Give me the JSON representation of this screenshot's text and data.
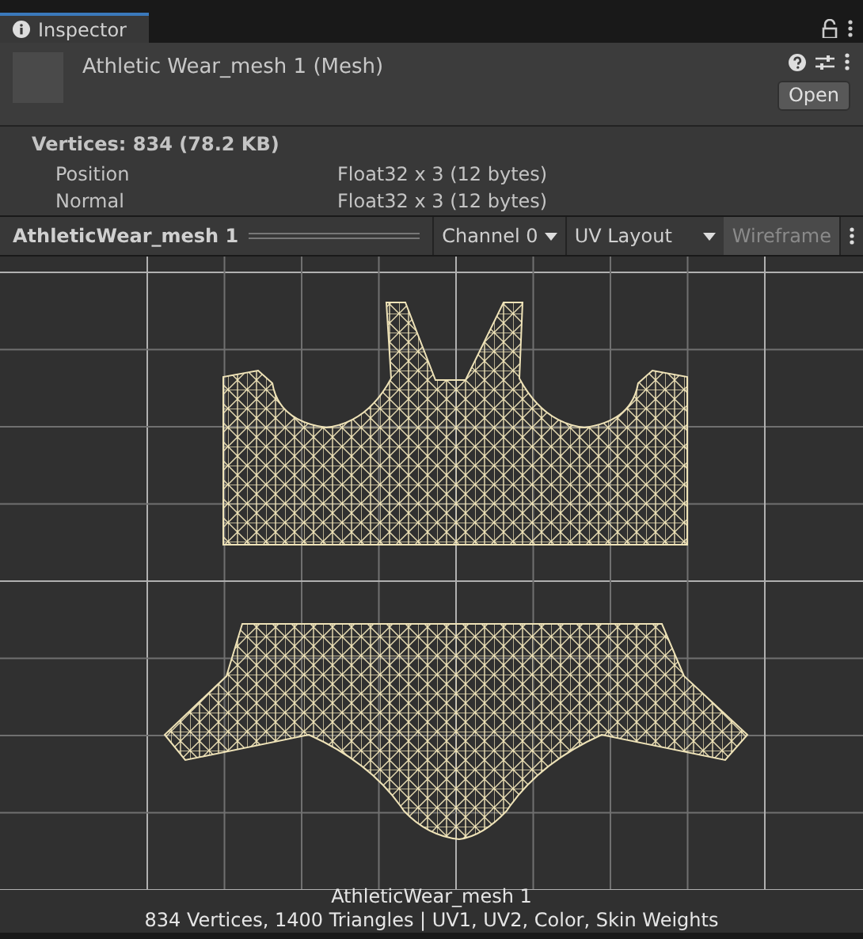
{
  "tab": {
    "title": "Inspector",
    "selected": true
  },
  "header": {
    "title": "Athletic Wear_mesh 1 (Mesh)",
    "open_button": "Open"
  },
  "properties": {
    "heading": "Vertices: 834 (78.2 KB)",
    "rows": [
      {
        "name": "Position",
        "value": "Float32 x 3 (12 bytes)"
      },
      {
        "name": "Normal",
        "value": "Float32 x 3 (12 bytes)"
      }
    ]
  },
  "preview_toolbar": {
    "title": "AthleticWear_mesh 1",
    "channel": "Channel 0",
    "mode": "UV Layout",
    "wireframe": {
      "label": "Wireframe",
      "disabled": true
    }
  },
  "preview_footer": {
    "name": "AthleticWear_mesh 1",
    "stats": "834 Vertices, 1400 Triangles | UV1, UV2, Color, Skin Weights"
  }
}
